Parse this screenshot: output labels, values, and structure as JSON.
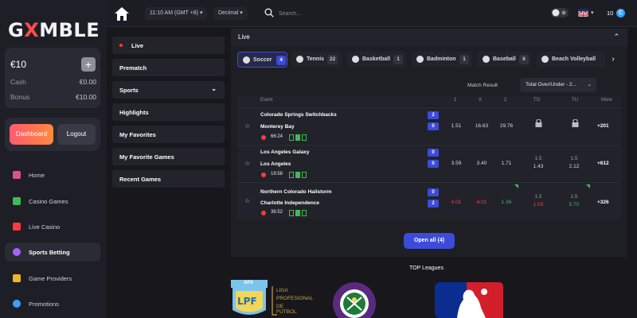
{
  "brand": {
    "logo_pre": "G",
    "logo_x": "X",
    "logo_post": "MBLE"
  },
  "wallet": {
    "balance": "€10",
    "add": "+",
    "rows": [
      {
        "label": "Cash",
        "value": "€0.00"
      },
      {
        "label": "Bonus",
        "value": "€10.00"
      }
    ]
  },
  "auth": {
    "dashboard": "Dashboard",
    "logout": "Logout"
  },
  "nav": [
    {
      "label": "Home",
      "icon": "home-icon",
      "color": "#e0508a"
    },
    {
      "label": "Casino Games",
      "icon": "dice-icon",
      "color": "#3dbb55"
    },
    {
      "label": "Live Casino",
      "icon": "play-icon",
      "color": "#ff3b3b"
    },
    {
      "label": "Sports Betting",
      "icon": "ball-icon",
      "color": "#a463ff",
      "active": true
    },
    {
      "label": "Game Providers",
      "icon": "providers-icon",
      "color": "#f0b428"
    },
    {
      "label": "Promotions",
      "icon": "promo-icon",
      "color": "#3aa0ff"
    }
  ],
  "topbar": {
    "time": "11:10 AM (GMT +8)",
    "odds_format": "Decimal",
    "search_placeholder": "Search...",
    "credits": "10",
    "coin": "C"
  },
  "sports_menu": [
    "Live",
    "Prematch",
    "Sports",
    "Highlights",
    "My Favorites",
    "My Favorite Games",
    "Recent Games"
  ],
  "live": {
    "title": "Live",
    "tabs": [
      {
        "label": "Soccer",
        "count": "4",
        "active": true
      },
      {
        "label": "Tennis",
        "count": "22"
      },
      {
        "label": "Basketball",
        "count": "1"
      },
      {
        "label": "Badminton",
        "count": "1"
      },
      {
        "label": "Baseball",
        "count": "6"
      },
      {
        "label": "Beach Volleyball",
        "count": ""
      }
    ],
    "match_result_label": "Match Result",
    "market_select": "Total Over/Under - 2...",
    "headers": {
      "event": "Event",
      "h1": "1",
      "hx": "X",
      "h2": "2",
      "to": "TO",
      "tu": "TU",
      "more": "More"
    },
    "events": [
      {
        "home": "Colorado Springs Switchbacks",
        "away": "Monterey Bay",
        "time": "66:24",
        "score_home": "2",
        "score_away": "0",
        "o1": "1.51",
        "ox": "16.63",
        "o2": "29.76",
        "to_a": "",
        "to_b": "",
        "tu_a": "",
        "tu_b": "",
        "more": "+201"
      },
      {
        "home": "Los Angeles Galaxy",
        "away": "Los Angeles",
        "time": "19:58",
        "score_home": "0",
        "score_away": "0",
        "o1": "3.59",
        "ox": "3.40",
        "o2": "1.71",
        "to_a": "1.5",
        "to_b": "1.43",
        "tu_a": "1.5",
        "tu_b": "2.12",
        "more": "+612"
      },
      {
        "home": "Northern Colorado Hailstorm",
        "away": "Charlotte Independence",
        "time": "36:52",
        "score_home": "0",
        "score_away": "2",
        "o1": "4.01",
        "ox": "4.01",
        "o2": "1.36",
        "to_a": "1.5",
        "to_b": "1.03",
        "tu_a": "1.5",
        "tu_b": "5.70",
        "more": "+326"
      }
    ],
    "open_all": "Open all (4)"
  },
  "top_leagues": {
    "title": "TOP Leagues",
    "liga": {
      "line1": "LIGA",
      "line2": "PROFESIONAL",
      "line3": "DE FÚTBOL",
      "mark": "LPF",
      "tag": "AFA"
    }
  },
  "colors": {
    "accent": "#3c4bd9",
    "live_red": "#ff3b3b",
    "green": "#3dbb55",
    "bg": "#17171c"
  }
}
